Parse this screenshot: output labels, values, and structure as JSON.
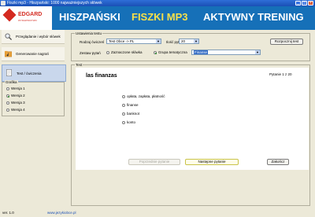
{
  "window": {
    "title": "Fiszki mp3 - Hiszpański: 1000 najważniejszych słówek",
    "controls": [
      "_",
      "□",
      "×"
    ]
  },
  "banner": {
    "logo_name": "EDGARD",
    "logo_sub": "WYDAWNICTWO",
    "words": [
      "HISZPAŃSKI",
      "FISZKI MP3",
      "AKTYWNY TRENING"
    ]
  },
  "sidebar": {
    "items": [
      {
        "label": "Przeglądanie i wybór słówek",
        "icon": "magnifier-icon"
      },
      {
        "label": "Generowanie nagrań",
        "icon": "music-folder-icon"
      },
      {
        "label": "Test / ćwiczenia",
        "icon": "document-icon"
      }
    ],
    "grafika": {
      "legend": "Grafika",
      "options": [
        "Wersja 1",
        "Wersja 2",
        "Wersja 3",
        "Wersja 4"
      ],
      "selected_index": 1
    },
    "version": "ver. 1.0",
    "url": "www.jezykiobce.pl"
  },
  "settings": {
    "legend": "Ustawienia testu",
    "exercise_type_label": "Rodzaj ćwiczeń",
    "exercise_type_value": "Test Obce -> PL",
    "question_count_label": "Ilość pytań",
    "question_count_value": "20",
    "start_button": "Rozpocznij test",
    "question_set_label": "Zestaw pytań",
    "option_marked": "Zaznaczone słówka",
    "option_theme": "Grupa tematyczna",
    "theme_value": "Finanse",
    "theme_selected": true
  },
  "test": {
    "legend": "Test",
    "word": "las finanzas",
    "counter": "Pytanie 1 z 20",
    "answers": [
      "opłata, zapłata, płatność",
      "finanse",
      "banknot",
      "konto"
    ],
    "prev_button": "Poprzednie pytanie",
    "next_button": "Następne pytanie",
    "finish_button": "Zakończ"
  }
}
